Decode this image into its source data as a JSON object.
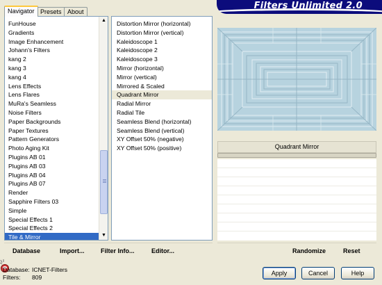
{
  "app": {
    "title": "Filters Unlimited 2.0"
  },
  "tabs": [
    {
      "label": "Navigator",
      "active": true
    },
    {
      "label": "Presets",
      "active": false
    },
    {
      "label": "About",
      "active": false
    }
  ],
  "categories": {
    "items": [
      "FunHouse",
      "Gradients",
      "Image Enhancement",
      "Johann's Filters",
      "kang 2",
      "kang 3",
      "kang 4",
      "Lens Effects",
      "Lens Flares",
      "MuRa's Seamless",
      "Noise Filters",
      "Paper Backgrounds",
      "Paper Textures",
      "Pattern Generators",
      "Photo Aging Kit",
      "Plugins AB 01",
      "Plugins AB 03",
      "Plugins AB 04",
      "Plugins AB 07",
      "Render",
      "Sapphire Filters 03",
      "Simple",
      "Special Effects 1",
      "Special Effects 2",
      "Tile & Mirror"
    ],
    "selected": "Tile & Mirror"
  },
  "filters": {
    "items": [
      "Distortion Mirror (horizontal)",
      "Distortion Mirror (vertical)",
      "Kaleidoscope 1",
      "Kaleidoscope 2",
      "Kaleidoscope 3",
      "Mirror (horizontal)",
      "Mirror (vertical)",
      "Mirrored & Scaled",
      "Quadrant Mirror",
      "Radial Mirror",
      "Radial Tile",
      "Seamless Blend (horizontal)",
      "Seamless Blend (vertical)",
      "XY Offset 50% (negative)",
      "XY Offset 50% (positive)"
    ],
    "selected": "Quadrant Mirror"
  },
  "preview": {
    "filter_name": "Quadrant Mirror",
    "bg_color": "#b7d3df"
  },
  "toolbar": {
    "database": "Database",
    "import": "Import...",
    "filter_info": "Filter Info...",
    "editor": "Editor...",
    "randomize": "Randomize",
    "reset": "Reset"
  },
  "status": {
    "database_label": "Database:",
    "database_value": "ICNET-Filters",
    "filters_label": "Filters:",
    "filters_value": "809"
  },
  "buttons": {
    "apply": "Apply",
    "cancel": "Cancel",
    "help": "Help"
  },
  "colors": {
    "banner": "#0c0c7c",
    "selection": "#316ac5",
    "window": "#ece9d8"
  }
}
